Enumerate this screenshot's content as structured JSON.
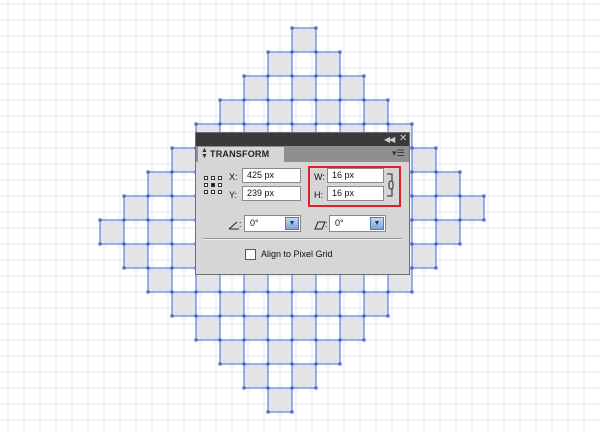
{
  "canvas": {
    "grid_color": "#e6e6f0",
    "cell_fill": "#e4e4e8",
    "edge_color": "#3c69d6",
    "anchor_color": "#3c69d6"
  },
  "panel": {
    "title": "TRANSFORM",
    "collapse_icon": "double-chevron-icon",
    "close_label": "✕",
    "menu_icon": "panel-menu-icon",
    "x_label": "X:",
    "x_value": "425 px",
    "y_label": "Y:",
    "y_value": "239 px",
    "w_label": "W:",
    "w_value": "16 px",
    "h_label": "H:",
    "h_value": "16 px",
    "rotate_value": "0°",
    "shear_value": "0°",
    "pixel_grid_label": "Align to Pixel Grid",
    "pixel_grid_checked": false,
    "highlight_color": "#d9232a"
  }
}
